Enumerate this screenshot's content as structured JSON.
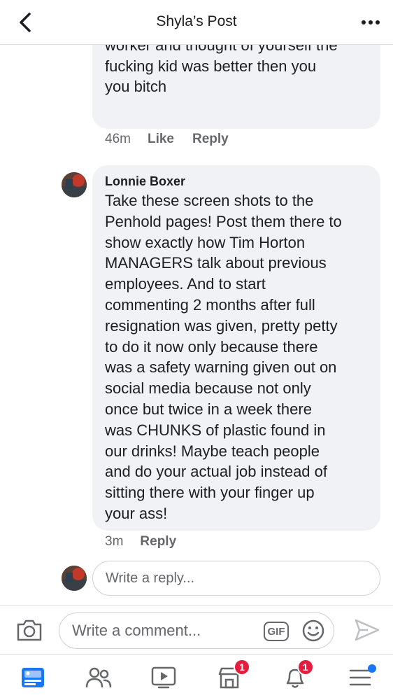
{
  "header": {
    "title": "Shyla’s Post",
    "back_icon": "chevron-left-icon",
    "more_icon": "more-horizontal-icon"
  },
  "comments": [
    {
      "text": "hated you cause you were a shit\nworker and thought of yourself the\nfucking kid was better then you\nyou bitch",
      "time": "46m",
      "like_label": "Like",
      "reply_label": "Reply"
    },
    {
      "author": "Lonnie Boxer",
      "text": "Take these screen shots to the\nPenhold pages! Post them there to\nshow exactly how Tim Horton\nMANAGERS talk about previous\nemployees. And to start\ncommenting 2 months after full\nresignation was given, pretty petty\nto do it now only because there\nwas a safety warning given out on\nsocial media because not only\nonce but twice in a week there\nwas CHUNKS of plastic found in\nour drinks! Maybe teach people\nand do your actual job instead of\nsitting there with your finger up\nyour ass!",
      "time": "3m",
      "reply_label": "Reply"
    }
  ],
  "reply_box": {
    "placeholder": "Write a reply..."
  },
  "composer": {
    "placeholder": "Write a comment...",
    "gif_label": "GIF"
  },
  "bottom_nav": {
    "items": [
      {
        "icon": "news-feed-icon"
      },
      {
        "icon": "friends-icon"
      },
      {
        "icon": "watch-icon"
      },
      {
        "icon": "marketplace-icon",
        "badge": "1"
      },
      {
        "icon": "notifications-icon",
        "badge": "1"
      },
      {
        "icon": "menu-icon"
      }
    ]
  },
  "colors": {
    "accent": "#1877f2",
    "badge": "#e41e3f",
    "bubble": "#f0f2f5",
    "secondary_text": "#65676b"
  }
}
